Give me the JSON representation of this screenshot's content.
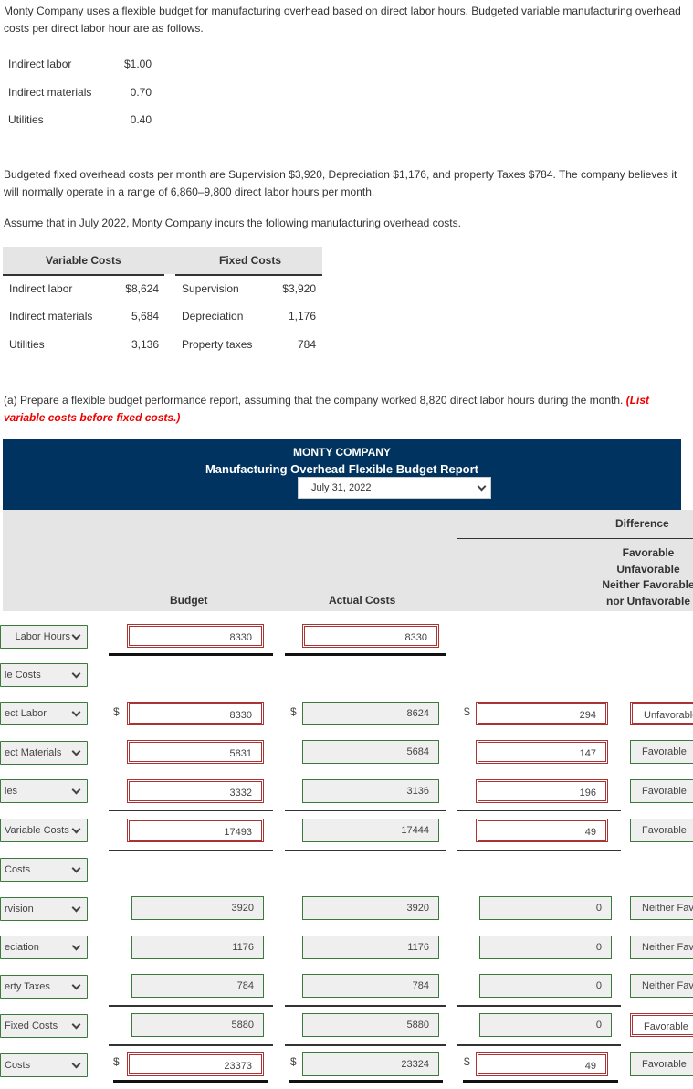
{
  "intro": {
    "paragraph1": "Monty Company uses a flexible budget for manufacturing overhead based on direct labor hours. Budgeted variable manufacturing overhead costs per direct labor hour are as follows.",
    "variable_rates": [
      {
        "label": "Indirect labor",
        "value": "$1.00"
      },
      {
        "label": "Indirect materials",
        "value": "0.70"
      },
      {
        "label": "Utilities",
        "value": "0.40"
      }
    ],
    "paragraph2": "Budgeted fixed overhead costs per month are Supervision $3,920, Depreciation $1,176, and property Taxes $784. The company believes it will normally operate in a range of 6,860–9,800 direct labor hours per month.",
    "paragraph3": "Assume that in July 2022, Monty Company incurs the following manufacturing overhead costs."
  },
  "incurred": {
    "variable_header": "Variable Costs",
    "fixed_header": "Fixed Costs",
    "variable": [
      {
        "label": "Indirect labor",
        "value": "$8,624"
      },
      {
        "label": "Indirect materials",
        "value": "5,684"
      },
      {
        "label": "Utilities",
        "value": "3,136"
      }
    ],
    "fixed": [
      {
        "label": "Supervision",
        "value": "$3,920"
      },
      {
        "label": "Depreciation",
        "value": "1,176"
      },
      {
        "label": "Property taxes",
        "value": "784"
      }
    ]
  },
  "question": {
    "text": "(a) Prepare a flexible budget performance report, assuming that the company worked 8,820 direct labor hours during the month. ",
    "note": "(List variable costs before fixed costs.)"
  },
  "report": {
    "company": "MONTY COMPANY",
    "title": "Manufacturing Overhead Flexible Budget Report",
    "date": "July 31, 2022",
    "col_budget": "Budget",
    "col_actual": "Actual Costs",
    "col_difference": "Difference",
    "col_fav_lines": [
      "Favorable",
      "Unfavorable",
      "Neither Favorable",
      "nor Unfavorable"
    ],
    "currency": "$",
    "rows": [
      {
        "label": "Labor Hours",
        "budget": "8330",
        "actual": "8330"
      },
      {
        "label": "le Costs"
      },
      {
        "label": "ect Labor",
        "budget": "8330",
        "actual": "8624",
        "diff": "294",
        "fav": "Unfavorable"
      },
      {
        "label": "ect Materials",
        "budget": "5831",
        "actual": "5684",
        "diff": "147",
        "fav": "Favorable"
      },
      {
        "label": "ies",
        "budget": "3332",
        "actual": "3136",
        "diff": "196",
        "fav": "Favorable"
      },
      {
        "label": "Variable Costs",
        "budget": "17493",
        "actual": "17444",
        "diff": "49",
        "fav": "Favorable"
      },
      {
        "label": "Costs"
      },
      {
        "label": "rvision",
        "budget": "3920",
        "actual": "3920",
        "diff": "0",
        "fav": "Neither Favorable nor Unfavorable"
      },
      {
        "label": "eciation",
        "budget": "1176",
        "actual": "1176",
        "diff": "0",
        "fav": "Neither Favorable nor Unfavorable"
      },
      {
        "label": "erty Taxes",
        "budget": "784",
        "actual": "784",
        "diff": "0",
        "fav": "Neither Favorable nor Unfavorable"
      },
      {
        "label": "Fixed Costs",
        "budget": "5880",
        "actual": "5880",
        "diff": "0",
        "fav": "Favorable"
      },
      {
        "label": "Costs",
        "budget": "23373",
        "actual": "23324",
        "diff": "49",
        "fav": "Favorable"
      }
    ]
  },
  "colors": {
    "header_bg": "#00335f",
    "band_bg": "#e5e5e5",
    "incorrect_border": "#aa3333",
    "correct_border": "#3b7a3b",
    "note_red": "#ee0000"
  }
}
